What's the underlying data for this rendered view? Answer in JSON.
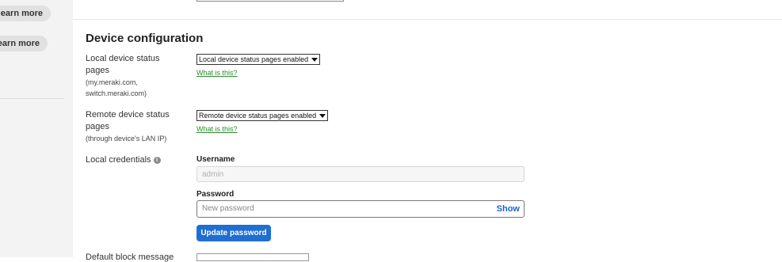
{
  "left_panel": {
    "learn_more_1": "earn more",
    "learn_more_2": "earn more"
  },
  "section": {
    "title": "Device configuration"
  },
  "local_status": {
    "label": "Local device status pages",
    "sub": "(my.meraki.com, switch.meraki.com)",
    "selected": "Local device status pages enabled",
    "help": "What is this?"
  },
  "remote_status": {
    "label": "Remote device status pages",
    "sub": "(through device's LAN IP)",
    "selected": "Remote device status pages enabled",
    "help": "What is this?"
  },
  "credentials": {
    "label": "Local credentials",
    "info_icon": "info-icon",
    "username_label": "Username",
    "username_value": "admin",
    "password_label": "Password",
    "password_placeholder": "New password",
    "show_label": "Show",
    "update_button": "Update password"
  },
  "next_row": {
    "label": "Default block message"
  },
  "colors": {
    "primary": "#1f6ed1",
    "link_green": "#2e8b2e",
    "show_blue": "#1e63c9"
  }
}
